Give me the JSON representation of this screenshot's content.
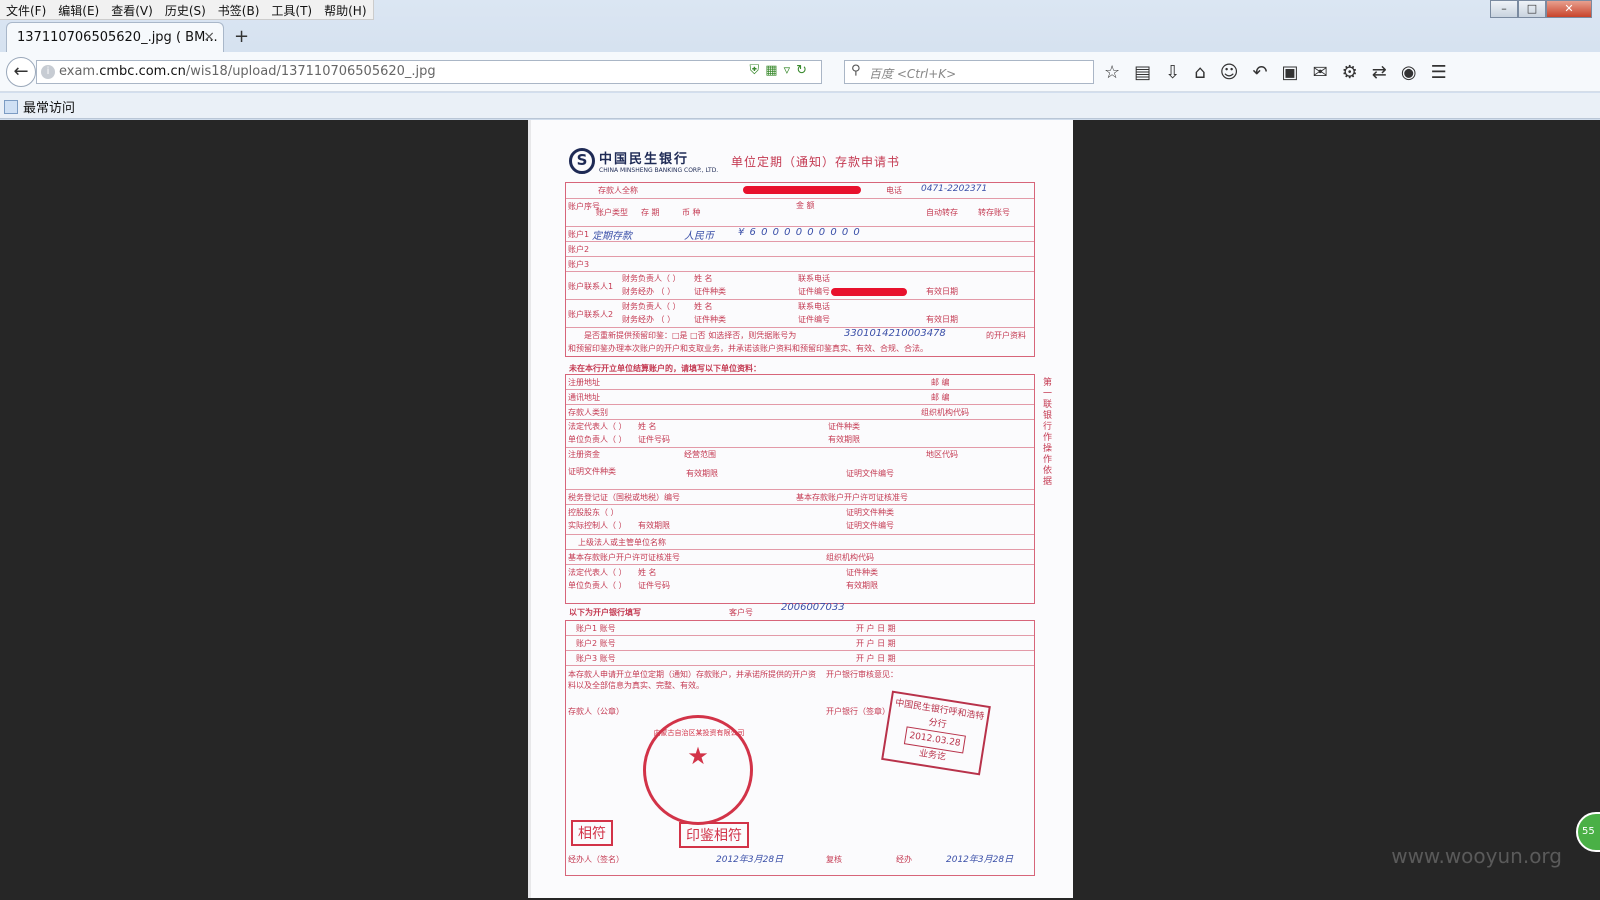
{
  "menu": [
    "文件(F)",
    "编辑(E)",
    "查看(V)",
    "历史(S)",
    "书签(B)",
    "工具(T)",
    "帮助(H)"
  ],
  "window_controls": {
    "minimize": "–",
    "maximize": "□",
    "close": "✕"
  },
  "tab": {
    "title": "137110706505620_.jpg ( BM...",
    "close": "×",
    "new_tab": "+"
  },
  "nav": {
    "url_prefix": "exam.",
    "url_domain": "cmbc.com.cn",
    "url_path": "/wis18/upload/137110706505620_.jpg",
    "search_placeholder": "百度 <Ctrl+K>"
  },
  "bookmarks_toolbar": {
    "item": "最常访问"
  },
  "document": {
    "bank_name_cn": "中国民生银行",
    "bank_name_en": "CHINA MINSHENG BANKING CORP., LTD.",
    "form_title": "单位定期（通知）存款申请书",
    "rows": {
      "depositor_label": "存款人全称",
      "phone_label": "电话",
      "account_no_label": "账户序号",
      "account_type_label": "账户类型",
      "term_label": "存  期",
      "currency_label": "币  种",
      "amount_label": "金  额",
      "auto_transfer_label": "自动转存",
      "transfer_account_label": "转存账号",
      "account1": "账户1",
      "account2": "账户2",
      "account3": "账户3",
      "contact1_label": "账户联系人1",
      "contact2_label": "账户联系人2",
      "finance_head": "财务负责人（  ）",
      "finance_staff": "财务经办  （  ）",
      "name_label": "姓  名",
      "id_type_label": "证件种类",
      "contact_phone_label": "联系电话",
      "id_number_label": "证件编号",
      "valid_date_label": "有效日期",
      "reuse_notice": "是否重新提供预留印鉴：□是 □否  如选择否，则凭据账号为",
      "reuse_account_suffix": "的开户资料",
      "reuse_notice2": "和预留印鉴办理本次账户的开户和支取业务，并承诺该账户资料和预留印鉴真实、有效、合规、合法。",
      "section_unopened": "未在本行开立单位结算账户的，请填写以下单位资料：",
      "reg_address": "注册地址",
      "mail_address": "通讯地址",
      "postcode": "邮  编",
      "depositor_category": "存款人类别",
      "org_code": "组织机构代码",
      "legal_rep": "法定代表人（  ）",
      "unit_head": "单位负责人（  ）",
      "id_no": "证件号码",
      "valid_period": "有效期限",
      "reg_capital": "注册资金",
      "business_scope": "经营范围",
      "region_code": "地区代码",
      "cert_doc": "证明文件种类",
      "cert_doc_no": "证明文件编号",
      "tax_cert": "税务登记证（国税或地税）编号",
      "basic_permit": "基本存款账户开户许可证核准号",
      "controlling_holder": "控股股东（  ）",
      "actual_controller": "实际控制人（  ）",
      "parent_unit": "上级法人或主管单位名称",
      "parent_permit": "基本存款账户开户许可证核准号",
      "bank_fill": "以下为开户银行填写",
      "customer_no": "客户号",
      "acct1_no": "账户1 账号",
      "acct2_no": "账户2 账号",
      "acct3_no": "账户3 账号",
      "open_date": "开 户 日 期",
      "declaration": "本存款人申请开立单位定期（通知）存款账户，并承诺所提供的开户资料以及全部信息为真实、完整、有效。",
      "bank_review": "开户银行审核意见：",
      "depositor_seal": "存款人（公章）",
      "bank_seal": "开户银行（签章）",
      "handler_sign": "经办人（签名）",
      "reviewer": "复核",
      "operator": "经办"
    },
    "handwriting": {
      "currency": "人民币",
      "account_type": "定期存款",
      "amount": "¥ 6 0 0 0 0 0 0 0 0 0",
      "reuse_account": "3301014210003478",
      "customer_no": "2006007033",
      "sign_date1": "2012年3月28日",
      "sign_date2": "2012年3月28日",
      "phone": "0471-2202371"
    },
    "stamps": {
      "seal_text": "内蒙古自治区某投资有限公司",
      "match1": "相符",
      "match2": "印鉴相符",
      "bank_stamp_line1": "中国民生银行呼和浩特分行",
      "bank_stamp_date": "2012.03.28",
      "bank_stamp_line2": "业务讫"
    },
    "side_label": "第一联 银行作操作依据"
  },
  "watermark": "www.wooyun.org",
  "badge": "55"
}
